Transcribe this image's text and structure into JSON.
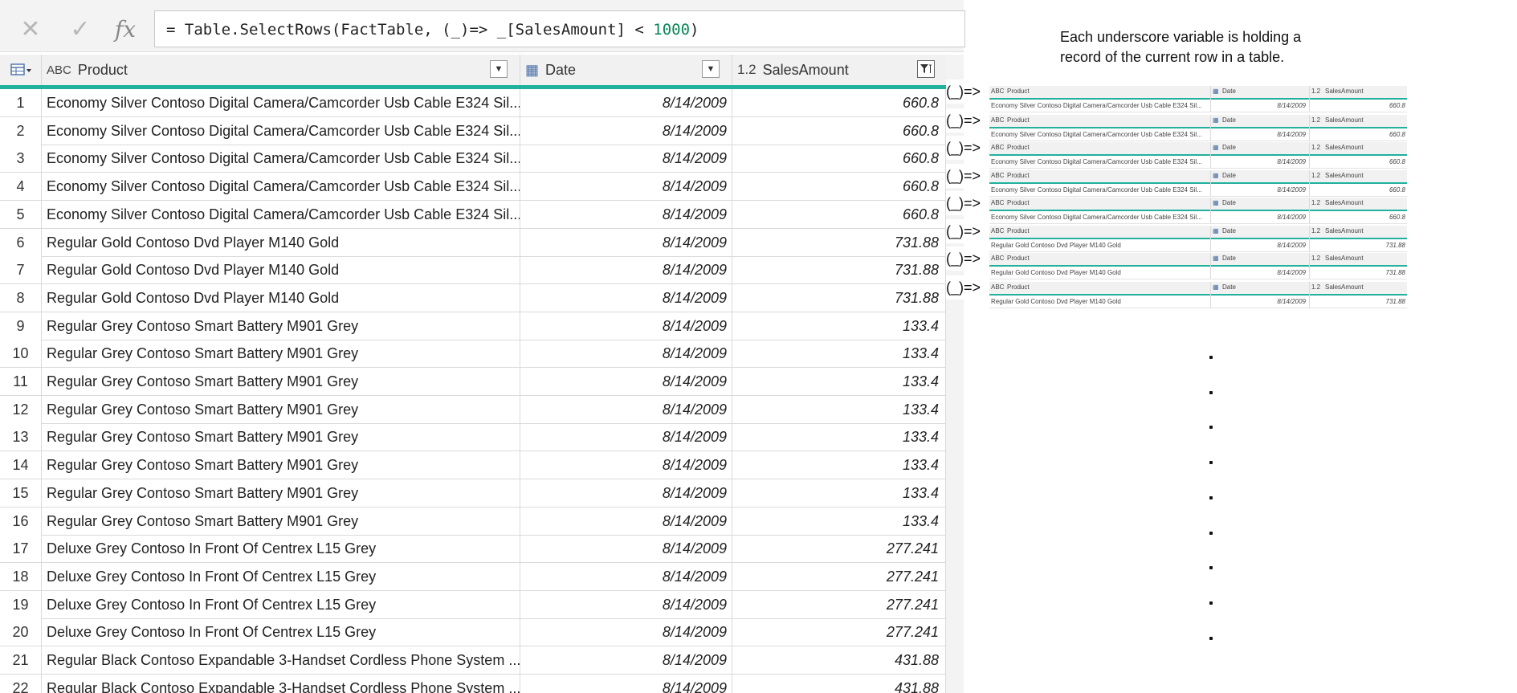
{
  "formula_bar": {
    "cancel_glyph": "✕",
    "commit_glyph": "✓",
    "fx_label": "fx",
    "formula_prefix": "= Table.SelectRows(FactTable, (_)=> _[SalesAmount] < ",
    "formula_number": "1000",
    "formula_suffix": ")"
  },
  "table": {
    "columns": [
      {
        "type_label": "ABC",
        "name": "Product"
      },
      {
        "type_label": "▦",
        "name": "Date"
      },
      {
        "type_label": "1.2",
        "name": "SalesAmount"
      }
    ],
    "rows": [
      {
        "idx": "1",
        "product": "Economy Silver Contoso Digital Camera/Camcorder Usb Cable E324 Sil...",
        "date": "8/14/2009",
        "amount": "660.8"
      },
      {
        "idx": "2",
        "product": "Economy Silver Contoso Digital Camera/Camcorder Usb Cable E324 Sil...",
        "date": "8/14/2009",
        "amount": "660.8"
      },
      {
        "idx": "3",
        "product": "Economy Silver Contoso Digital Camera/Camcorder Usb Cable E324 Sil...",
        "date": "8/14/2009",
        "amount": "660.8"
      },
      {
        "idx": "4",
        "product": "Economy Silver Contoso Digital Camera/Camcorder Usb Cable E324 Sil...",
        "date": "8/14/2009",
        "amount": "660.8"
      },
      {
        "idx": "5",
        "product": "Economy Silver Contoso Digital Camera/Camcorder Usb Cable E324 Sil...",
        "date": "8/14/2009",
        "amount": "660.8"
      },
      {
        "idx": "6",
        "product": "Regular Gold Contoso Dvd Player M140 Gold",
        "date": "8/14/2009",
        "amount": "731.88"
      },
      {
        "idx": "7",
        "product": "Regular Gold Contoso Dvd Player M140 Gold",
        "date": "8/14/2009",
        "amount": "731.88"
      },
      {
        "idx": "8",
        "product": "Regular Gold Contoso Dvd Player M140 Gold",
        "date": "8/14/2009",
        "amount": "731.88"
      },
      {
        "idx": "9",
        "product": "Regular Grey Contoso Smart Battery M901 Grey",
        "date": "8/14/2009",
        "amount": "133.4"
      },
      {
        "idx": "10",
        "product": "Regular Grey Contoso Smart Battery M901 Grey",
        "date": "8/14/2009",
        "amount": "133.4"
      },
      {
        "idx": "11",
        "product": "Regular Grey Contoso Smart Battery M901 Grey",
        "date": "8/14/2009",
        "amount": "133.4"
      },
      {
        "idx": "12",
        "product": "Regular Grey Contoso Smart Battery M901 Grey",
        "date": "8/14/2009",
        "amount": "133.4"
      },
      {
        "idx": "13",
        "product": "Regular Grey Contoso Smart Battery M901 Grey",
        "date": "8/14/2009",
        "amount": "133.4"
      },
      {
        "idx": "14",
        "product": "Regular Grey Contoso Smart Battery M901 Grey",
        "date": "8/14/2009",
        "amount": "133.4"
      },
      {
        "idx": "15",
        "product": "Regular Grey Contoso Smart Battery M901 Grey",
        "date": "8/14/2009",
        "amount": "133.4"
      },
      {
        "idx": "16",
        "product": "Regular Grey Contoso Smart Battery M901 Grey",
        "date": "8/14/2009",
        "amount": "133.4"
      },
      {
        "idx": "17",
        "product": "Deluxe Grey Contoso In Front Of Centrex L15 Grey",
        "date": "8/14/2009",
        "amount": "277.241"
      },
      {
        "idx": "18",
        "product": "Deluxe Grey Contoso In Front Of Centrex L15 Grey",
        "date": "8/14/2009",
        "amount": "277.241"
      },
      {
        "idx": "19",
        "product": "Deluxe Grey Contoso In Front Of Centrex L15 Grey",
        "date": "8/14/2009",
        "amount": "277.241"
      },
      {
        "idx": "20",
        "product": "Deluxe Grey Contoso In Front Of Centrex L15 Grey",
        "date": "8/14/2009",
        "amount": "277.241"
      },
      {
        "idx": "21",
        "product": "Regular Black Contoso Expandable 3-Handset Cordless Phone System ...",
        "date": "8/14/2009",
        "amount": "431.88"
      },
      {
        "idx": "22",
        "product": "Regular Black Contoso Expandable 3-Handset Cordless Phone System ...",
        "date": "8/14/2009",
        "amount": "431.88"
      }
    ]
  },
  "annotation": {
    "note_line1": "Each underscore variable is holding a",
    "note_line2": "record of the current row in a table.",
    "lambda_label": "(_)=>",
    "mini_header": {
      "type_product": "ABC",
      "product": "Product",
      "date": "Date",
      "type_amount": "1.2",
      "amount": "SalesAmount"
    },
    "mini_records": [
      {
        "product": "Economy Silver Contoso Digital Camera/Camcorder Usb Cable E324 Sil...",
        "date": "8/14/2009",
        "amount": "660.8"
      },
      {
        "product": "Economy Silver Contoso Digital Camera/Camcorder Usb Cable E324 Sil...",
        "date": "8/14/2009",
        "amount": "660.8"
      },
      {
        "product": "Economy Silver Contoso Digital Camera/Camcorder Usb Cable E324 Sil...",
        "date": "8/14/2009",
        "amount": "660.8"
      },
      {
        "product": "Economy Silver Contoso Digital Camera/Camcorder Usb Cable E324 Sil...",
        "date": "8/14/2009",
        "amount": "660.8"
      },
      {
        "product": "Economy Silver Contoso Digital Camera/Camcorder Usb Cable E324 Sil...",
        "date": "8/14/2009",
        "amount": "660.8"
      },
      {
        "product": "Regular Gold Contoso Dvd Player M140 Gold",
        "date": "8/14/2009",
        "amount": "731.88"
      },
      {
        "product": "Regular Gold Contoso Dvd Player M140 Gold",
        "date": "8/14/2009",
        "amount": "731.88"
      },
      {
        "product": "Regular Gold Contoso Dvd Player M140 Gold",
        "date": "8/14/2009",
        "amount": "731.88"
      }
    ],
    "ellipsis_dot_count": 9
  },
  "colors": {
    "accent_teal": "#21b19e",
    "number_green": "#098658"
  }
}
